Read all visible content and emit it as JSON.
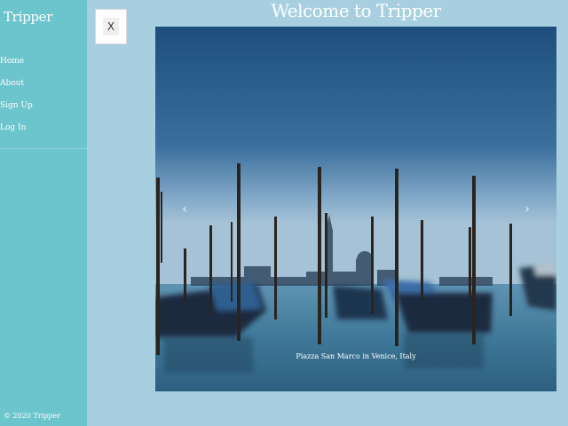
{
  "sidebar": {
    "brand": "Tripper",
    "nav": [
      "Home",
      "About",
      "Sign Up",
      "Log In"
    ],
    "footer": "© 2020 Tripper"
  },
  "close_button": {
    "label": "X"
  },
  "main": {
    "title": "Welcome to Tripper",
    "carousel": {
      "caption": "Piazza San Marco in Venice, Italy",
      "prev_icon": "chevron-left-icon",
      "next_icon": "chevron-right-icon"
    }
  },
  "colors": {
    "sidebar_bg": "#6cc4cc",
    "page_bg": "#a8cfe0"
  }
}
